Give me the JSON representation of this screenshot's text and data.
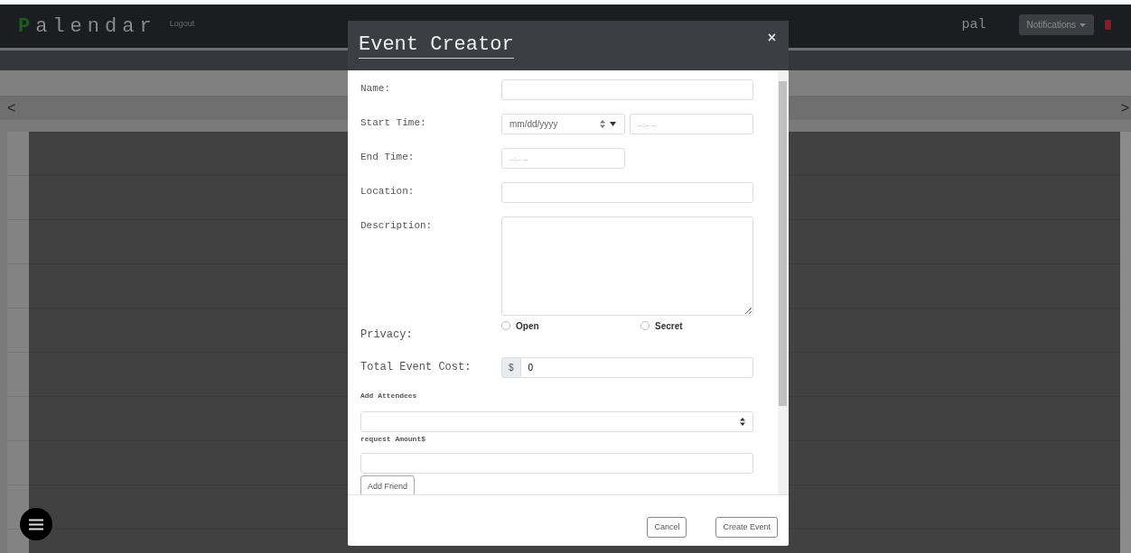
{
  "navbar": {
    "logo_initial": "P",
    "logo_rest": "alendar",
    "logout": "Logout",
    "username": "pal",
    "notifications": "Notifications"
  },
  "calendar": {
    "prev": "<",
    "next": ">"
  },
  "modal": {
    "title": "Event Creator",
    "close": "×",
    "fields": [
      {
        "kind": "text",
        "label": "Name:"
      },
      {
        "kind": "datetime",
        "label": "Start Time:",
        "date_placeholder": "mm/dd/yyyy",
        "time_placeholder": "--:-- --"
      },
      {
        "kind": "time",
        "label": "End Time:",
        "time_placeholder": "--:-- --"
      },
      {
        "kind": "text",
        "label": "Location:"
      },
      {
        "kind": "textarea",
        "label": "Description:"
      },
      {
        "kind": "radio",
        "label": "Privacy:",
        "options": [
          {
            "label": "Open",
            "selected": false
          },
          {
            "label": "Secret",
            "selected": false
          }
        ]
      },
      {
        "kind": "money",
        "label": "Total Event Cost:",
        "prefix": "$",
        "value": "0"
      }
    ],
    "attendees": {
      "heading": "Add Attendees",
      "amount_label": "request Amount$",
      "add_button": "Add Friend"
    },
    "buttons": [
      "Cancel",
      "Create Event"
    ]
  }
}
